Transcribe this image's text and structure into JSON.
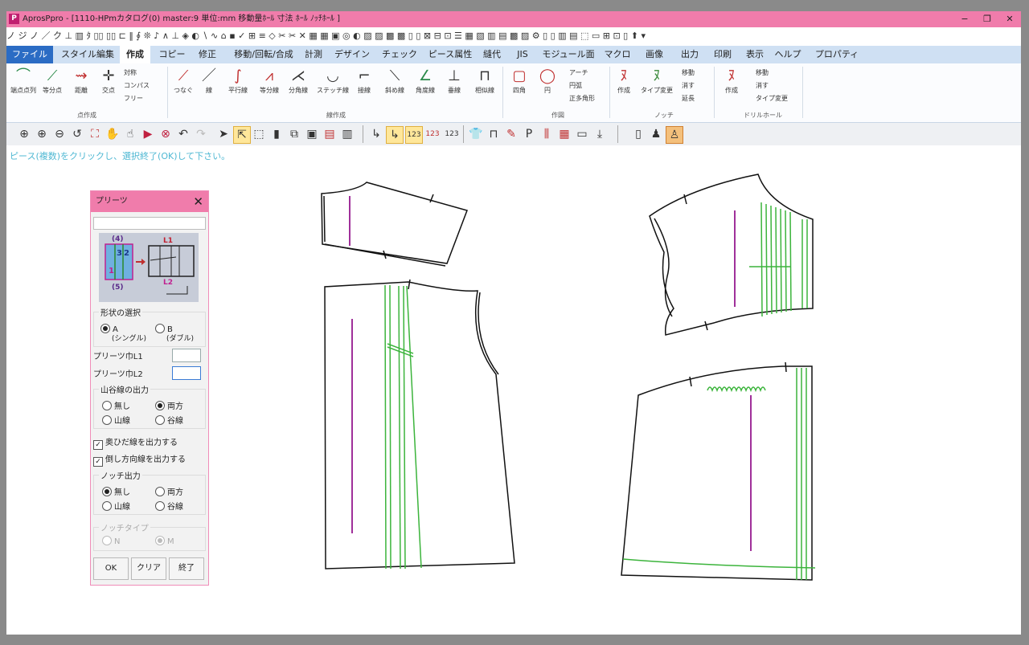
{
  "window": {
    "title": "AprosPpro - [1110-HPmカタログ(0)  master:9  単位:mm 移動量ﾎｰﾙ 寸法  ﾎｰﾙ ﾉｯﾁﾎｰﾙ ]",
    "app_icon": "P",
    "min": "−",
    "restore": "❐",
    "close": "✕"
  },
  "quick_access": "ノ ジ ノ ／ ク ⊥ ▥ ﾀ ▯▯ ▯▯ ⊏ ‖ ∮ ❊ ♪ ∧ ⊥ ◈ ◐ ∖ ∿ ⌂ ▪ ✓ ⊞ ≡ ◇ ✂ ✂ ✕ ▦ ▦ ▣ ◎ ◐ ▨ ▨ ▩ ▩ ▯ ▯ ⊠ ⊟ ⊡ ☰ ▦ ▧ ▥ ▤ ▩ ▨ ⚙ ▯ ▯ ▥ ▤ ⬚ ▭ ⊞ ⊡ ▯ ⬆ ▾",
  "menu": {
    "tabs": [
      "ファイル",
      "スタイル編集",
      "作成",
      "コピー",
      "修正",
      "移動/回転/合成",
      "計測",
      "デザイン",
      "チェック",
      "ピース属性",
      "縫代",
      "JIS",
      "モジュール面",
      "マクロ",
      "画像",
      "出力",
      "印刷",
      "表示",
      "ヘルプ",
      "プロパティ"
    ],
    "active_index": 2
  },
  "ribbon": {
    "buttons": [
      "端点点列",
      "等分点",
      "距離",
      "交点",
      "つなぐ",
      "線",
      "平行線",
      "等分線",
      "分角線",
      "ステッチ線",
      "接線",
      "斜め線",
      "角度線",
      "垂線",
      "相似線",
      "四角",
      "円",
      "作成",
      "タイプ変更",
      "作成"
    ],
    "small": [
      "対称",
      "コンパス",
      "フリー",
      "アーチ",
      "円弧",
      "正多角形",
      "移動",
      "消す",
      "延長",
      "移動",
      "消す",
      "タイプ変更"
    ],
    "groups": [
      "点作成",
      "線作成",
      "作図",
      "ノッチ",
      "ドリルホール"
    ]
  },
  "status": {
    "message": "ピース(複数)をクリックし、選択終了(OK)して下さい。"
  },
  "dialog": {
    "title": "プリーツ",
    "close": "✕",
    "diagram_labels": {
      "l1": "L1",
      "l2": "L2",
      "n4": "(4)",
      "n5": "(5)",
      "n1": "1",
      "n2": "2",
      "n3": "3"
    },
    "shape_group": "形状の選択",
    "shape_a": "A",
    "shape_a_sub": "(シングル)",
    "shape_b": "B",
    "shape_b_sub": "(ダブル)",
    "shape_selected": "A",
    "width_l1_label": "プリーツ巾L1",
    "width_l1_value": "",
    "width_l2_label": "プリーツ巾L2",
    "width_l2_value": "",
    "fold_group": "山谷線の出力",
    "fold_none": "無し",
    "fold_both": "両方",
    "fold_mountain": "山線",
    "fold_valley": "谷線",
    "fold_selected": "両方",
    "check_depth": "奥ひだ線を出力する",
    "check_direction": "倒し方向線を出力する",
    "notch_group": "ノッチ出力",
    "notch_none": "無し",
    "notch_both": "両方",
    "notch_mountain": "山線",
    "notch_valley": "谷線",
    "notch_selected": "無し",
    "notch_type_group": "ノッチタイプ",
    "notch_type_n": "N",
    "notch_type_m": "M",
    "btn_ok": "OK",
    "btn_clear": "クリア",
    "btn_end": "終了"
  },
  "colors": {
    "titlebar": "#f07cab",
    "ribbon_tab_bar": "#cfe0f3",
    "pleat_line": "#3cb43c",
    "grain_line": "#a0309a",
    "status_text": "#4fb8d3"
  }
}
